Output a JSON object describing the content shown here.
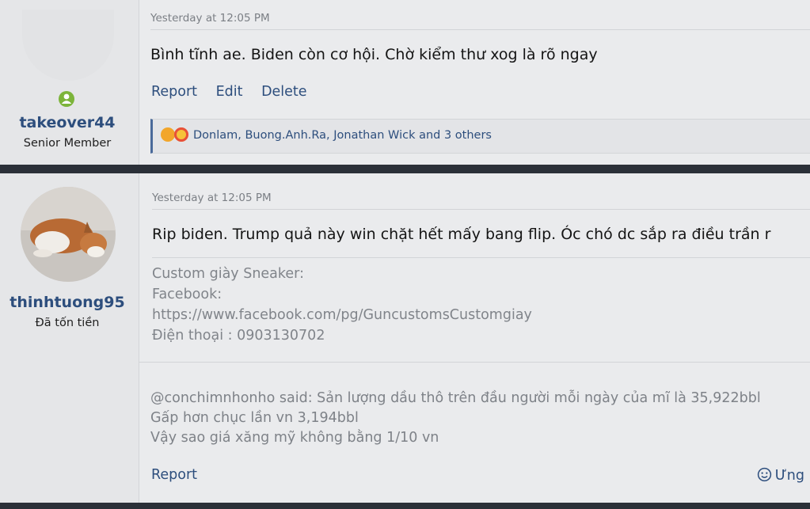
{
  "post1": {
    "timestamp": "Yesterday at 12:05 PM",
    "message": "Bình tĩnh ae. Biden còn cơ hội. Chờ kiểm thư xog là rõ ngay",
    "actions": [
      "Report",
      "Edit",
      "Delete"
    ],
    "reactions_text": "Donlam, Buong.Anh.Ra, Jonathan Wick and 3 others",
    "user": {
      "name": "takeover44",
      "title": "Senior Member"
    }
  },
  "post2": {
    "timestamp": "Yesterday at 12:05 PM",
    "message": "Rip biden. Trump quả này win chặt hết mấy bang flip. Óc chó dc sắp ra điều trần r",
    "signature": [
      "Custom giày Sneaker:",
      "Facebook:",
      "https://www.facebook.com/pg/GuncustomsCustomgiay",
      "Điện thoại : 0903130702"
    ],
    "quote": [
      "@conchimnhonho said: Sản lượng dầu thô trên đầu người mỗi ngày của mĩ là 35,922bbl",
      "Gấp hơn chục lần vn 3,194bbl",
      "Vậy sao giá xăng mỹ không bằng 1/10 vn"
    ],
    "report_label": "Report",
    "react_label": "Ưng",
    "user": {
      "name": "thinhtuong95",
      "title": "Đã tốn tiền"
    }
  },
  "colors": {
    "link": "#2d4e7d",
    "online": "#7cb43a",
    "divider": "#2b3038"
  },
  "icons": {
    "online": "online-status-icon",
    "react": "smiley-icon"
  }
}
